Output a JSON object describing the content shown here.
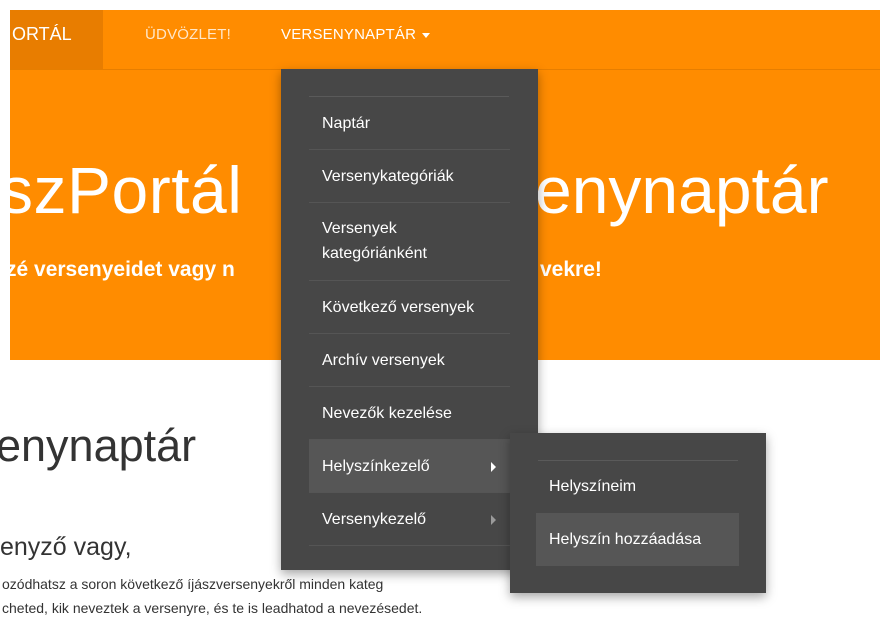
{
  "navbar": {
    "brand": "ORTÁL",
    "welcome": "ÜDVÖZLET!",
    "calendar": "VERSENYNAPTÁR"
  },
  "hero": {
    "title_left": "szPortál",
    "title_right": "enynaptár",
    "subtitle_left": "zé versenyeidet vagy n",
    "subtitle_right": "vekre!"
  },
  "content": {
    "page_title": "enynaptár",
    "subheading": "enyző vagy,",
    "para_line1": "ozódhatsz a soron következő íjászversenyekről minden kateg",
    "para_line2": "cheted, kik neveztek a versenyre, és te is leadhatod a nevezésedet."
  },
  "dropdown": {
    "items": [
      {
        "label": "Naptár"
      },
      {
        "label": "Versenykategóriák"
      },
      {
        "label_line1": "Versenyek",
        "label_line2": "kategóriánként"
      },
      {
        "label": "Következő versenyek"
      },
      {
        "label": "Archív versenyek"
      },
      {
        "label": "Nevezők kezelése"
      },
      {
        "label": "Helyszínkezelő"
      },
      {
        "label": "Versenykezelő"
      }
    ]
  },
  "submenu": {
    "items": [
      {
        "label": "Helyszíneim"
      },
      {
        "label": "Helyszín hozzáadása"
      }
    ]
  },
  "colors": {
    "accent": "#ff8c00",
    "menu_bg": "#474747",
    "menu_active": "#565656"
  }
}
